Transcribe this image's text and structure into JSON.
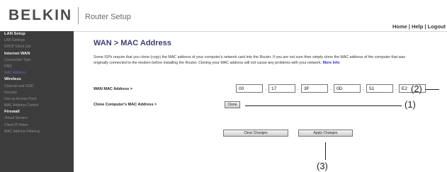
{
  "header": {
    "logo": "BELKIN",
    "app_title": "Router Setup",
    "top_links": "Home | Help | Logout"
  },
  "sidebar": {
    "items": [
      {
        "label": "LAN Setup",
        "type": "head"
      },
      {
        "label": "LAN Settings",
        "type": "item"
      },
      {
        "label": "DHCP Client List",
        "type": "item"
      },
      {
        "label": "Internet WAN",
        "type": "head"
      },
      {
        "label": "Connection Type",
        "type": "item"
      },
      {
        "label": "DNS",
        "type": "item"
      },
      {
        "label": "MAC Address",
        "type": "active"
      },
      {
        "label": "Wireless",
        "type": "head"
      },
      {
        "label": "Channel and SSID",
        "type": "item"
      },
      {
        "label": "Security",
        "type": "item"
      },
      {
        "label": "Use as Access Point",
        "type": "item"
      },
      {
        "label": "MAC Address Control",
        "type": "item"
      },
      {
        "label": "Firewall",
        "type": "head"
      },
      {
        "label": "Virtual Servers",
        "type": "item"
      },
      {
        "label": "Client IP Filters",
        "type": "item"
      },
      {
        "label": "MAC Address Filtering",
        "type": "item"
      }
    ]
  },
  "main": {
    "title": "WAN > MAC Address",
    "description": "Some ISPs require that you clone (copy) the MAC address of your computer's network card into the Router. If you are not sure then simply clone the MAC address of the computer that was originally connected to the modem before installing the Router. Cloning your MAC address will not cause any problems with your network.",
    "more_info": "More Info",
    "wan_mac_label": "WAN MAC Address >",
    "mac_octets": [
      "00",
      "17",
      "3F",
      "0D",
      "51",
      "E2"
    ],
    "clone_label": "Clone Computer's MAC Address >",
    "clone_button": "Clone",
    "clear_button": "Clear Changes",
    "apply_button": "Apply Changes"
  },
  "callouts": {
    "c1": "(1)",
    "c2": "(2)",
    "c3": "(3)"
  }
}
